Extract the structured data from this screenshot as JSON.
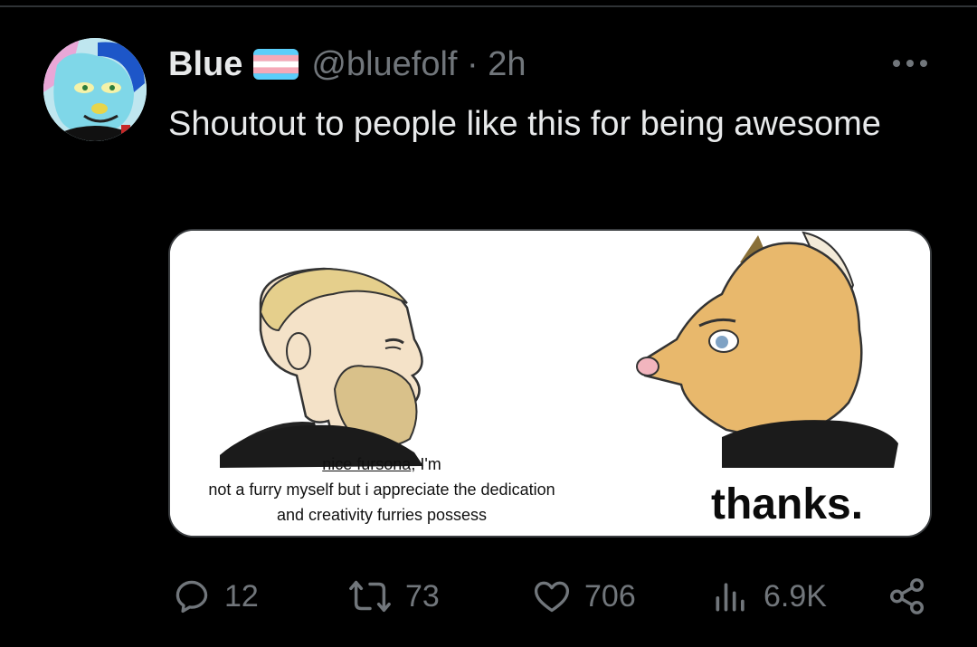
{
  "tweet": {
    "display_name": "Blue",
    "handle_line": "@bluefolf · 2h",
    "text": "Shoutout to people like this for being awesome",
    "flag_colors": [
      "#5bcefa",
      "#f5a9b8",
      "#ffffff",
      "#f5a9b8",
      "#5bcefa"
    ],
    "more_icon": "more-horizontal-icon"
  },
  "meme": {
    "left_caption_a": "nice fursona",
    "left_caption_b": ", I'm",
    "left_caption_line2": "not a furry myself but i appreciate the dedication",
    "left_caption_line3": "and creativity furries possess",
    "right_caption": "thanks."
  },
  "actions": {
    "replies": "12",
    "reposts": "73",
    "likes": "706",
    "views": "6.9K",
    "icons": [
      "reply-icon",
      "repost-icon",
      "like-icon",
      "views-icon",
      "share-icon"
    ]
  }
}
